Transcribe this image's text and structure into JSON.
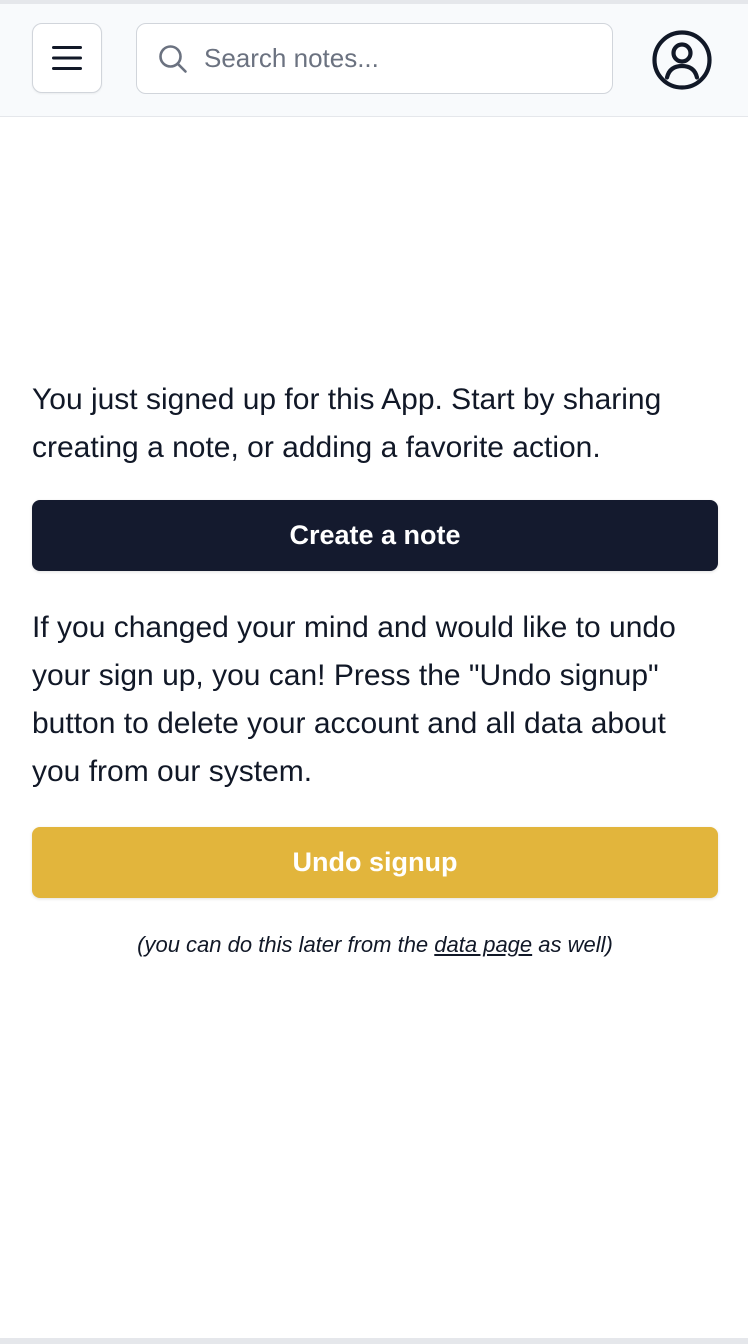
{
  "header": {
    "menu_icon": "hamburger-menu-icon",
    "search": {
      "placeholder": "Search notes...",
      "value": "",
      "icon": "search-icon"
    },
    "account_icon": "user-circle-icon"
  },
  "main": {
    "intro_text": "You just signed up for this App. Start by sharing creating a note, or adding a favorite action.",
    "create_button_label": "Create a note",
    "undo_text": "If you changed your mind and would like to undo your sign up, you can! Press the \"Undo signup\" button to delete your account and all data about you from our system.",
    "undo_button_label": "Undo signup",
    "footnote": {
      "prefix": "(you can do this later from the ",
      "link_text": "data page",
      "suffix": " as well)"
    }
  },
  "colors": {
    "primary_button": "#141a2e",
    "undo_button": "#e2b53c",
    "header_bg": "#f8fafc"
  }
}
